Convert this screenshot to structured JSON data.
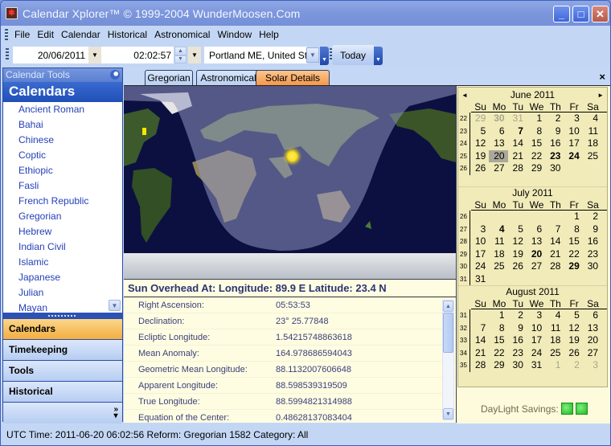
{
  "window": {
    "title": "Calendar Xplorer™ © 1999-2004 WunderMoosen.Com",
    "app_icon": "moose-app-icon",
    "controls": {
      "minimize": "_",
      "maximize": "□",
      "close": "✕"
    }
  },
  "menubar": {
    "items": [
      "File",
      "Edit",
      "Calendar",
      "Historical",
      "Astronomical",
      "Window",
      "Help"
    ]
  },
  "toolbar": {
    "date_value": "20/06/2011",
    "time_value": "02:02:57",
    "location_value": "Portland ME, United Sta",
    "today_label": "Today"
  },
  "sidebar": {
    "header": "Calendar Tools",
    "caption": "Calendars",
    "items": [
      "Ancient Roman",
      "Bahai",
      "Chinese",
      "Coptic",
      "Ethiopic",
      "Fasli",
      "French Republic",
      "Gregorian",
      "Hebrew",
      "Indian Civil",
      "Islamic",
      "Japanese",
      "Julian",
      "Mayan"
    ],
    "nav_buttons": [
      {
        "label": "Calendars",
        "active": true
      },
      {
        "label": "Timekeeping",
        "active": false
      },
      {
        "label": "Tools",
        "active": false
      },
      {
        "label": "Historical",
        "active": false
      }
    ],
    "more_glyph": "»"
  },
  "tabs": [
    {
      "label": "Gregorian",
      "active": false
    },
    {
      "label": "Astronomical",
      "active": false
    },
    {
      "label": "Solar Details",
      "active": true
    }
  ],
  "tab_close": "×",
  "map": {
    "sun_position": {
      "longitude": 89.9,
      "longitude_dir": "E",
      "latitude": 23.4,
      "latitude_dir": "N"
    },
    "observer_location": "Portland ME, United States"
  },
  "sun_header": "Sun Overhead At:  Longitude: 89.9 E   Latitude: 23.4 N",
  "details": [
    {
      "label": "Right Ascension:",
      "value": "05:53:53"
    },
    {
      "label": "Declination:",
      "value": "23° 25.77848"
    },
    {
      "label": "Ecliptic Longitude:",
      "value": "1.54215748863618"
    },
    {
      "label": "Mean Anomaly:",
      "value": "164.978686594043"
    },
    {
      "label": "Geometric Mean Longitude:",
      "value": "88.1132007606648"
    },
    {
      "label": "Apparent Longitude:",
      "value": "88.598539319509"
    },
    {
      "label": "True Longitude:",
      "value": "88.5994821314988"
    },
    {
      "label": "Equation of the Center:",
      "value": "0.48628137083404"
    }
  ],
  "calendar": {
    "weekday_headers": [
      "Su",
      "Mo",
      "Tu",
      "We",
      "Th",
      "Fr",
      "Sa"
    ],
    "months": [
      {
        "title": "June 2011",
        "weeks": [
          {
            "wk": "22",
            "days": [
              {
                "d": "29",
                "o": 1
              },
              {
                "d": "30",
                "o": 1,
                "b": 1
              },
              {
                "d": "31",
                "o": 1
              },
              {
                "d": "1"
              },
              {
                "d": "2"
              },
              {
                "d": "3"
              },
              {
                "d": "4"
              }
            ]
          },
          {
            "wk": "23",
            "days": [
              {
                "d": "5"
              },
              {
                "d": "6"
              },
              {
                "d": "7",
                "b": 1
              },
              {
                "d": "8"
              },
              {
                "d": "9"
              },
              {
                "d": "10"
              },
              {
                "d": "11"
              }
            ]
          },
          {
            "wk": "24",
            "days": [
              {
                "d": "12"
              },
              {
                "d": "13"
              },
              {
                "d": "14"
              },
              {
                "d": "15"
              },
              {
                "d": "16"
              },
              {
                "d": "17"
              },
              {
                "d": "18"
              }
            ]
          },
          {
            "wk": "25",
            "days": [
              {
                "d": "19"
              },
              {
                "d": "20",
                "s": 1
              },
              {
                "d": "21"
              },
              {
                "d": "22"
              },
              {
                "d": "23",
                "b": 1
              },
              {
                "d": "24",
                "b": 1
              },
              {
                "d": "25"
              }
            ]
          },
          {
            "wk": "26",
            "days": [
              {
                "d": "26"
              },
              {
                "d": "27"
              },
              {
                "d": "28"
              },
              {
                "d": "29"
              },
              {
                "d": "30"
              },
              {
                "d": ""
              },
              {
                "d": ""
              }
            ]
          }
        ]
      },
      {
        "title": "July 2011",
        "weeks": [
          {
            "wk": "26",
            "days": [
              {
                "d": ""
              },
              {
                "d": ""
              },
              {
                "d": ""
              },
              {
                "d": ""
              },
              {
                "d": ""
              },
              {
                "d": "1"
              },
              {
                "d": "2"
              }
            ]
          },
          {
            "wk": "27",
            "days": [
              {
                "d": "3"
              },
              {
                "d": "4",
                "b": 1
              },
              {
                "d": "5"
              },
              {
                "d": "6"
              },
              {
                "d": "7"
              },
              {
                "d": "8"
              },
              {
                "d": "9"
              }
            ]
          },
          {
            "wk": "28",
            "days": [
              {
                "d": "10"
              },
              {
                "d": "11"
              },
              {
                "d": "12"
              },
              {
                "d": "13"
              },
              {
                "d": "14"
              },
              {
                "d": "15"
              },
              {
                "d": "16"
              }
            ]
          },
          {
            "wk": "29",
            "days": [
              {
                "d": "17"
              },
              {
                "d": "18"
              },
              {
                "d": "19"
              },
              {
                "d": "20",
                "b": 1
              },
              {
                "d": "21"
              },
              {
                "d": "22"
              },
              {
                "d": "23"
              }
            ]
          },
          {
            "wk": "30",
            "days": [
              {
                "d": "24"
              },
              {
                "d": "25"
              },
              {
                "d": "26"
              },
              {
                "d": "27"
              },
              {
                "d": "28"
              },
              {
                "d": "29",
                "b": 1
              },
              {
                "d": "30"
              }
            ]
          },
          {
            "wk": "31",
            "days": [
              {
                "d": "31"
              },
              {
                "d": ""
              },
              {
                "d": ""
              },
              {
                "d": ""
              },
              {
                "d": ""
              },
              {
                "d": ""
              },
              {
                "d": ""
              }
            ]
          }
        ]
      },
      {
        "title": "August 2011",
        "weeks": [
          {
            "wk": "31",
            "days": [
              {
                "d": ""
              },
              {
                "d": "1"
              },
              {
                "d": "2"
              },
              {
                "d": "3"
              },
              {
                "d": "4"
              },
              {
                "d": "5"
              },
              {
                "d": "6"
              }
            ]
          },
          {
            "wk": "32",
            "days": [
              {
                "d": "7"
              },
              {
                "d": "8"
              },
              {
                "d": "9"
              },
              {
                "d": "10"
              },
              {
                "d": "11"
              },
              {
                "d": "12"
              },
              {
                "d": "13"
              }
            ]
          },
          {
            "wk": "33",
            "days": [
              {
                "d": "14"
              },
              {
                "d": "15"
              },
              {
                "d": "16"
              },
              {
                "d": "17"
              },
              {
                "d": "18"
              },
              {
                "d": "19"
              },
              {
                "d": "20"
              }
            ]
          },
          {
            "wk": "34",
            "days": [
              {
                "d": "21"
              },
              {
                "d": "22"
              },
              {
                "d": "23"
              },
              {
                "d": "24"
              },
              {
                "d": "25"
              },
              {
                "d": "26"
              },
              {
                "d": "27"
              }
            ]
          },
          {
            "wk": "35",
            "days": [
              {
                "d": "28"
              },
              {
                "d": "29"
              },
              {
                "d": "30"
              },
              {
                "d": "31"
              },
              {
                "d": "1",
                "o": 1
              },
              {
                "d": "2",
                "o": 1
              },
              {
                "d": "3",
                "o": 1
              }
            ]
          }
        ]
      }
    ],
    "nav_prev": "◄",
    "nav_next": "►"
  },
  "daylight_savings_label": "DayLight Savings:",
  "daylight_savings_indicators": 2,
  "statusbar": {
    "text": "UTC Time: 2011-06-20 06:02:56  Reform: Gregorian 1582  Category: All"
  }
}
